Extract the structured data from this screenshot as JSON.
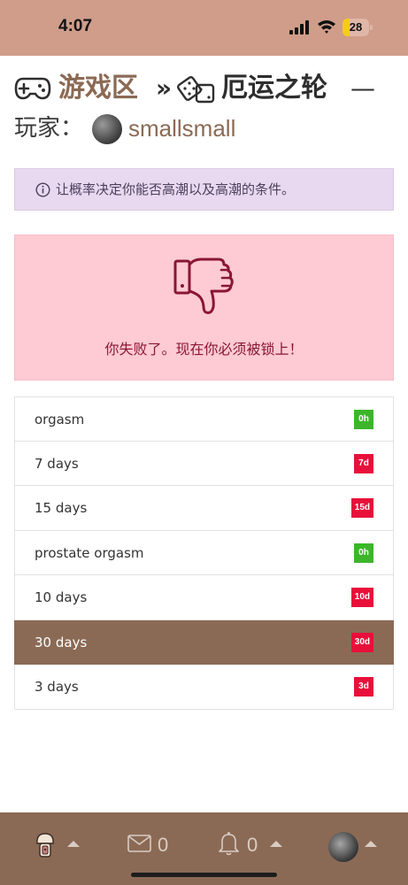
{
  "status_bar": {
    "time": "4:07",
    "battery_percent": "28",
    "battery_level": 0.28
  },
  "header": {
    "section_link": "游戏区",
    "separator": "»",
    "current_game": "厄运之轮",
    "dash": "—",
    "player_label": "玩家：",
    "player_name": "smallsmall"
  },
  "info": {
    "text": "让概率决定你能否高潮以及高潮的条件。",
    "icon": "info-circle-icon"
  },
  "result": {
    "icon": "thumbs-down-icon",
    "message": "你失败了。现在你必须被锁上！"
  },
  "outcomes": [
    {
      "label": "orgasm",
      "badge": "0h",
      "badge_color": "#3db52b",
      "active": false
    },
    {
      "label": "7 days",
      "badge": "7d",
      "badge_color": "#e8103a",
      "active": false
    },
    {
      "label": "15 days",
      "badge": "15d",
      "badge_color": "#e8103a",
      "active": false
    },
    {
      "label": "prostate orgasm",
      "badge": "0h",
      "badge_color": "#3db52b",
      "active": false
    },
    {
      "label": "10 days",
      "badge": "10d",
      "badge_color": "#e8103a",
      "active": false
    },
    {
      "label": "30 days",
      "badge": "30d",
      "badge_color": "#e8103a",
      "active": true
    },
    {
      "label": "3 days",
      "badge": "3d",
      "badge_color": "#e8103a",
      "active": false
    }
  ],
  "bottom_nav": {
    "mail_count": "0",
    "notification_count": "0"
  },
  "colors": {
    "accent": "#8b6a55",
    "status_bar": "#cf9d8a",
    "info_bg": "#e9d9f0",
    "danger_bg": "#fecad4",
    "danger_text": "#8a1634"
  }
}
